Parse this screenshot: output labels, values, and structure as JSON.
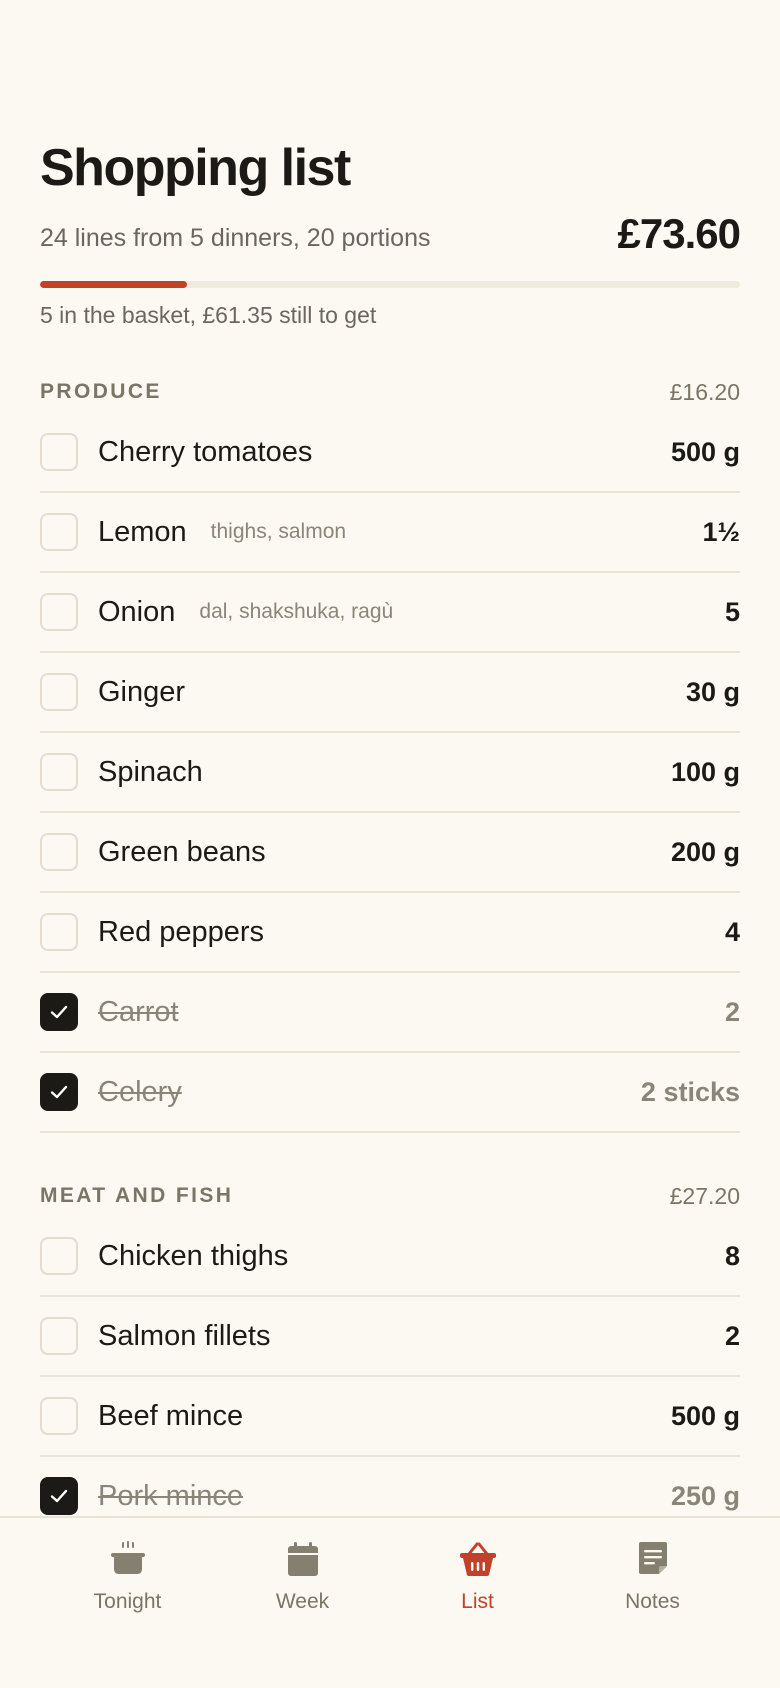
{
  "header": {
    "title": "Shopping list",
    "subtitle": "24 lines from 5 dinners, 20 portions",
    "total": "£73.60",
    "progress_fraction": 0.21,
    "basket_status": "5 in the basket, £61.35 still to get",
    "accent_color": "#c2412d"
  },
  "sections": [
    {
      "name": "PRODUCE",
      "total": "£16.20",
      "items": [
        {
          "name": "Cherry tomatoes",
          "note": "",
          "qty": "500 g",
          "checked": false
        },
        {
          "name": "Lemon",
          "note": "thighs, salmon",
          "qty": "1½",
          "checked": false
        },
        {
          "name": "Onion",
          "note": "dal, shakshuka, ragù",
          "qty": "5",
          "checked": false
        },
        {
          "name": "Ginger",
          "note": "",
          "qty": "30 g",
          "checked": false
        },
        {
          "name": "Spinach",
          "note": "",
          "qty": "100 g",
          "checked": false
        },
        {
          "name": "Green beans",
          "note": "",
          "qty": "200 g",
          "checked": false
        },
        {
          "name": "Red peppers",
          "note": "",
          "qty": "4",
          "checked": false
        },
        {
          "name": "Carrot",
          "note": "",
          "qty": "2",
          "checked": true
        },
        {
          "name": "Celery",
          "note": "",
          "qty": "2 sticks",
          "checked": true
        }
      ]
    },
    {
      "name": "MEAT AND FISH",
      "total": "£27.20",
      "items": [
        {
          "name": "Chicken thighs",
          "note": "",
          "qty": "8",
          "checked": false
        },
        {
          "name": "Salmon fillets",
          "note": "",
          "qty": "2",
          "checked": false
        },
        {
          "name": "Beef mince",
          "note": "",
          "qty": "500 g",
          "checked": false
        },
        {
          "name": "Pork mince",
          "note": "",
          "qty": "250 g",
          "checked": true
        }
      ]
    }
  ],
  "tabs": [
    {
      "label": "Tonight",
      "icon": "pot-icon",
      "active": false
    },
    {
      "label": "Week",
      "icon": "calendar-icon",
      "active": false
    },
    {
      "label": "List",
      "icon": "basket-icon",
      "active": true
    },
    {
      "label": "Notes",
      "icon": "notes-icon",
      "active": false
    }
  ]
}
